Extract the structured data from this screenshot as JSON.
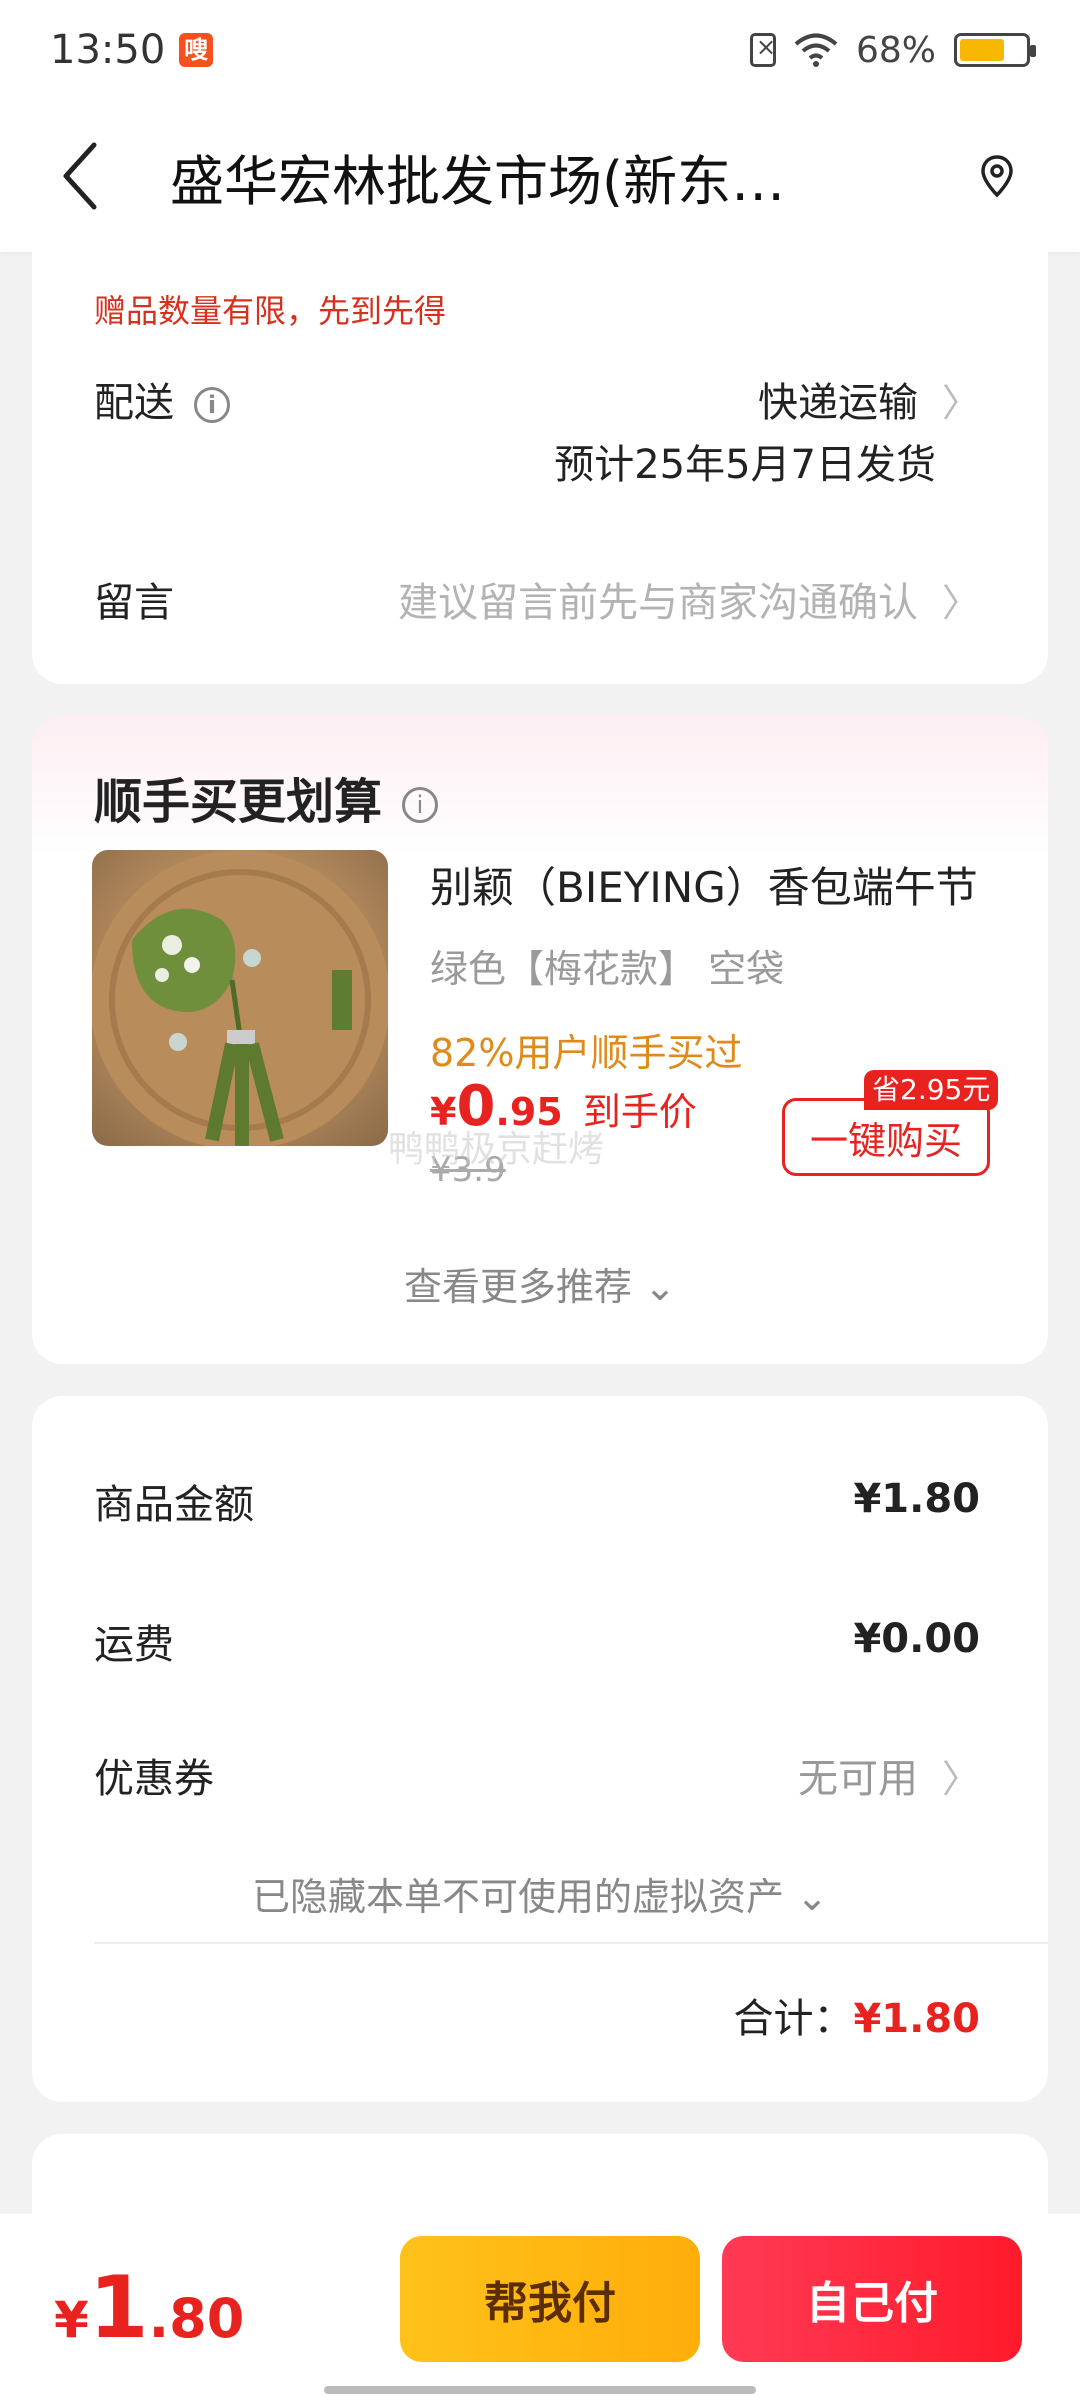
{
  "status_bar": {
    "time": "13:50",
    "app_badge": "嗖",
    "battery": "68%",
    "battery_fill": 0.68
  },
  "nav": {
    "title": "盛华宏林批发市场(新东…"
  },
  "order": {
    "gift_note": "赠品数量有限，先到先得",
    "delivery_label": "配送",
    "delivery_method": "快递运输",
    "delivery_eta": "预计25年5月7日发货",
    "message_label": "留言",
    "message_placeholder": "建议留言前先与商家沟通确认"
  },
  "recommend": {
    "title": "顺手买更划算",
    "product_name": "别颖（BIEYING）香包端午节",
    "spec": "绿色【梅花款】  空袋",
    "bought": "82%用户顺手买过",
    "price_yen": "¥",
    "price_int": "0",
    "price_dec": ".95",
    "price_tag": "到手价",
    "orig_price": "¥3.9",
    "save_badge": "省2.95元",
    "buy_button": "一键购买",
    "more": "查看更多推荐 ⌄",
    "watermark": "鸭鸭极京赶烤"
  },
  "summary": {
    "goods_label": "商品金额",
    "goods_value": "¥1.80",
    "shipping_label": "运费",
    "shipping_value": "¥0.00",
    "coupon_label": "优惠券",
    "coupon_value": "无可用",
    "hidden_assets": "已隐藏本单不可使用的虚拟资产 ⌄",
    "total_label": "合计：",
    "total_value": "¥1.80"
  },
  "bottom": {
    "yen": "¥",
    "price_int": "1",
    "price_dec": ".80",
    "help_pay": "帮我付",
    "self_pay": "自己付"
  },
  "colors": {
    "accent_red": "#e8231f",
    "accent_yellow": "#ffb90f"
  }
}
